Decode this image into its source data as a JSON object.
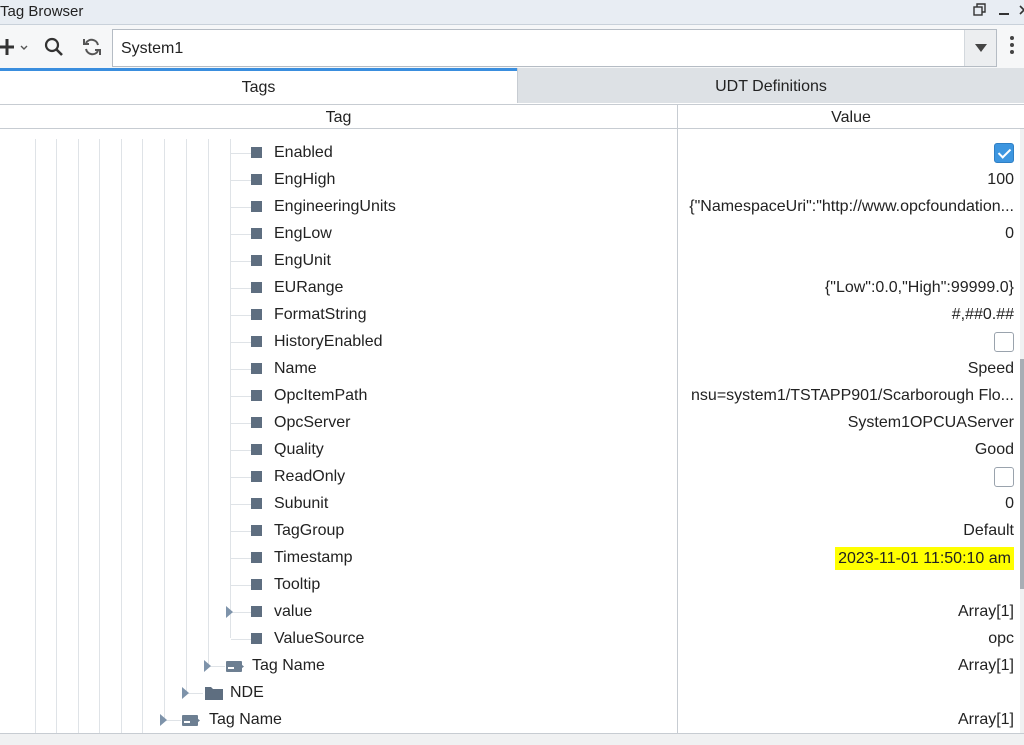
{
  "window": {
    "title": "Tag Browser"
  },
  "toolbar": {
    "provider_value": "System1"
  },
  "tabs": [
    {
      "label": "Tags"
    },
    {
      "label": "UDT Definitions"
    }
  ],
  "columns": {
    "tag": "Tag",
    "value": "Value"
  },
  "rows": [
    {
      "name": "Enabled",
      "type": "checkbox",
      "checked": true
    },
    {
      "name": "EngHigh",
      "value": "100"
    },
    {
      "name": "EngineeringUnits",
      "value": "{\"NamespaceUri\":\"http://www.opcfoundation..."
    },
    {
      "name": "EngLow",
      "value": "0"
    },
    {
      "name": "EngUnit",
      "value": ""
    },
    {
      "name": "EURange",
      "value": "{\"Low\":0.0,\"High\":99999.0}"
    },
    {
      "name": "FormatString",
      "value": "#,##0.##"
    },
    {
      "name": "HistoryEnabled",
      "type": "checkbox",
      "checked": false
    },
    {
      "name": "Name",
      "value": "Speed"
    },
    {
      "name": "OpcItemPath",
      "value": "nsu=system1/TSTAPP901/Scarborough Flo..."
    },
    {
      "name": "OpcServer",
      "value": "System1OPCUAServer"
    },
    {
      "name": "Quality",
      "value": "Good"
    },
    {
      "name": "ReadOnly",
      "type": "checkbox",
      "checked": false
    },
    {
      "name": "Subunit",
      "value": "0"
    },
    {
      "name": "TagGroup",
      "value": "Default"
    },
    {
      "name": "Timestamp",
      "value": "2023-11-01 11:50:10 am",
      "highlight": "#ffff00"
    },
    {
      "name": "Tooltip",
      "value": ""
    },
    {
      "name": "value",
      "value": "Array[1]",
      "expandable": true
    },
    {
      "name": "ValueSource",
      "value": "opc"
    }
  ],
  "parent_rows": [
    {
      "name": "Tag Name",
      "value": "Array[1]",
      "icon": "tag-icon"
    },
    {
      "name": "NDE",
      "value": "",
      "icon": "folder-icon"
    },
    {
      "name": "Tag Name",
      "value": "Array[1]",
      "icon": "tag-icon"
    }
  ],
  "colors": {
    "accent": "#3a8ede",
    "highlight": "#ffff00",
    "leaf_icon": "#5e6e80"
  }
}
